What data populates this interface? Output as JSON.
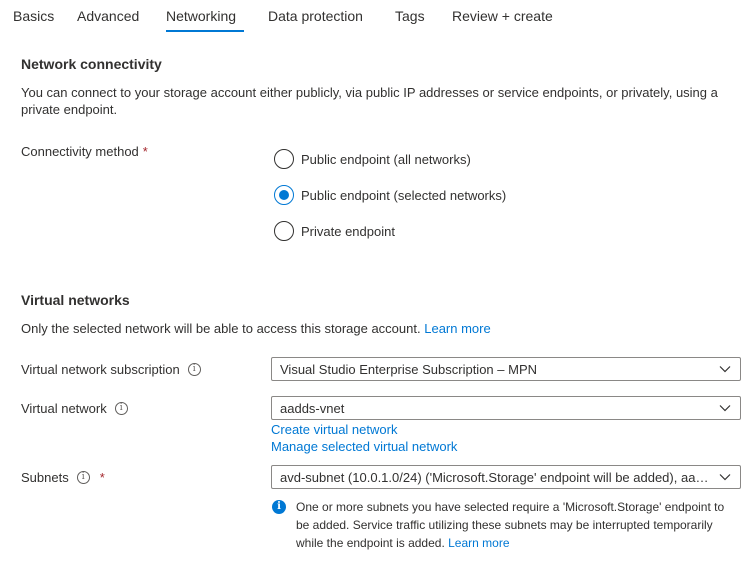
{
  "tabs": [
    {
      "label": "Basics"
    },
    {
      "label": "Advanced"
    },
    {
      "label": "Networking"
    },
    {
      "label": "Data protection"
    },
    {
      "label": "Tags"
    },
    {
      "label": "Review + create"
    }
  ],
  "active_tab": "Networking",
  "connectivity": {
    "title": "Network connectivity",
    "description": "You can connect to your storage account either publicly, via public IP addresses or service endpoints, or privately, using a private endpoint.",
    "method_label": "Connectivity method",
    "required_mark": "*",
    "options": [
      {
        "label": "Public endpoint (all networks)",
        "checked": false
      },
      {
        "label": "Public endpoint (selected networks)",
        "checked": true
      },
      {
        "label": "Private endpoint",
        "checked": false
      }
    ]
  },
  "vnets": {
    "title": "Virtual networks",
    "description": "Only the selected network will be able to access this storage account.",
    "learn_more": "Learn more",
    "subscription_label": "Virtual network subscription",
    "subscription_value": "Visual Studio Enterprise Subscription – MPN",
    "vnet_label": "Virtual network",
    "vnet_value": "aadds-vnet",
    "create_vnet_link": "Create virtual network",
    "manage_vnet_link": "Manage selected virtual network",
    "subnets_label": "Subnets",
    "subnets_required": "*",
    "subnets_value": "avd-subnet (10.0.1.0/24) ('Microsoft.Storage' endpoint will be added), aad...",
    "info_message": "One or more subnets you have selected require a 'Microsoft.Storage' endpoint to be added. Service traffic utilizing these subnets may be interrupted temporarily while the endpoint is added.",
    "info_learn_more": "Learn more"
  },
  "colors": {
    "accent": "#0078d4",
    "required": "#a4262c",
    "text": "#323130"
  },
  "icons": {
    "info": "info-circle-icon",
    "chevron": "chevron-down-icon"
  }
}
